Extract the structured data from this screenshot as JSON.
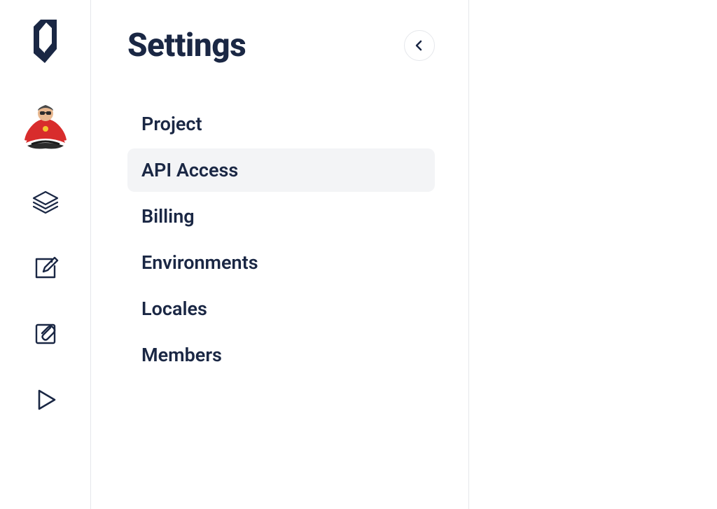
{
  "header": {
    "title": "Settings"
  },
  "settings_nav": {
    "items": [
      {
        "label": "Project",
        "active": false
      },
      {
        "label": "API Access",
        "active": true
      },
      {
        "label": "Billing",
        "active": false
      },
      {
        "label": "Environments",
        "active": false
      },
      {
        "label": "Locales",
        "active": false
      },
      {
        "label": "Members",
        "active": false
      }
    ]
  },
  "icons": {
    "logo": "app-logo",
    "avatar": "meditation-avatar",
    "layers": "layers-icon",
    "edit": "edit-icon",
    "attach": "attachment-edit-icon",
    "play": "play-icon",
    "back": "chevron-left-icon"
  },
  "colors": {
    "text": "#1a2744",
    "border": "#e5e7eb",
    "active_bg": "#f3f4f6",
    "avatar_red": "#d82c2c",
    "avatar_skin": "#e8b890"
  }
}
